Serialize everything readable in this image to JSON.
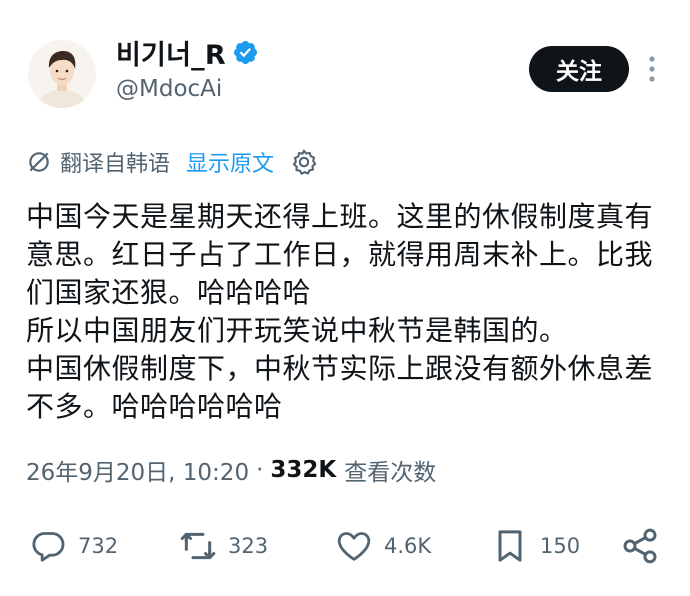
{
  "author": {
    "display_name": "비기너_R",
    "handle": "@MdocAi"
  },
  "header": {
    "follow_label": "关注"
  },
  "translation": {
    "label": "翻译自韩语",
    "show_original": "显示原文"
  },
  "tweet": {
    "text": "中国今天是星期天还得上班。这里的休假制度真有意思。红日子占了工作日，就得用周末补上。比我们国家还狠。哈哈哈哈\n所以中国朋友们开玩笑说中秋节是韩国的。\n中国休假制度下，中秋节实际上跟没有额外休息差不多。哈哈哈哈哈哈",
    "timestamp": "26年9月20日, 10:20",
    "separator": "·",
    "views_count": "332K",
    "views_label": "查看次数"
  },
  "actions": {
    "replies": "732",
    "retweets": "323",
    "likes": "4.6K",
    "bookmarks": "150"
  },
  "colors": {
    "text": "#0f1419",
    "secondary": "#536471",
    "link": "#1d9bf0",
    "verified": "#1d9bf0",
    "button_bg": "#0f1419"
  },
  "icons": [
    "verified-badge-icon",
    "more-vertical-icon",
    "translate-icon",
    "settings-gear-icon",
    "reply-icon",
    "retweet-icon",
    "like-heart-icon",
    "bookmark-icon",
    "share-icon"
  ]
}
